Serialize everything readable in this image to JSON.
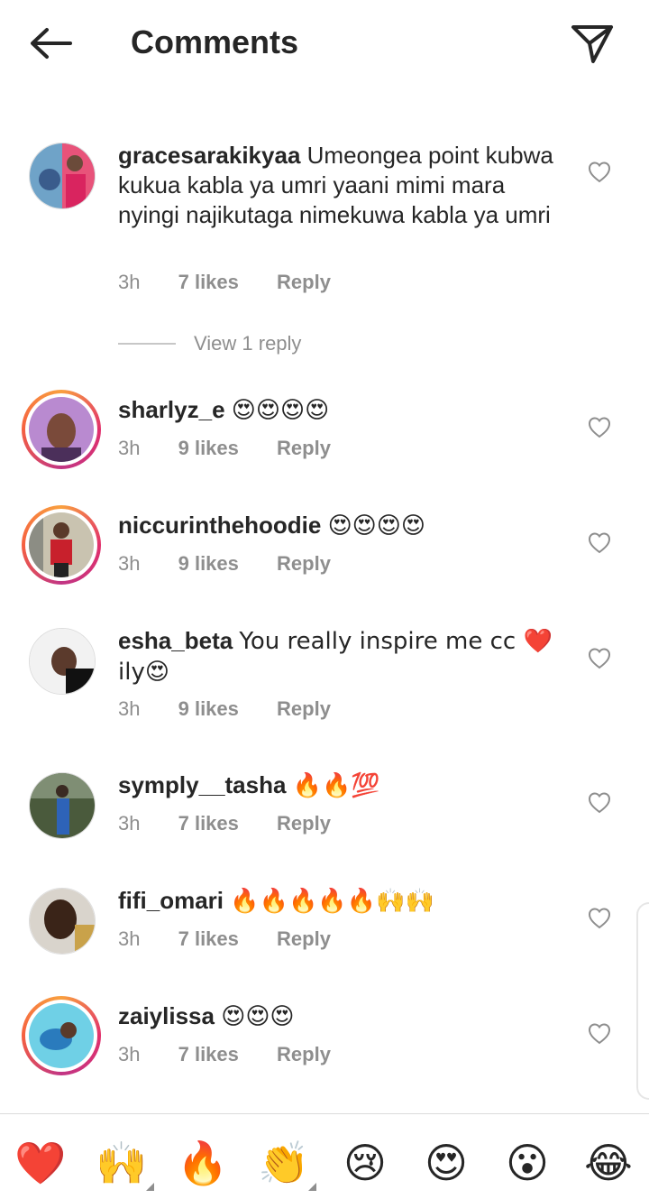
{
  "header": {
    "title": "Comments"
  },
  "comments": [
    {
      "username": "gracesarakikyaa",
      "text": "Umeongea point kubwa kukua kabla ya umri yaani mimi mara nyingi najikutaga nimekuwa kabla ya umri",
      "time": "3h",
      "likes": "7 likes",
      "reply": "Reply"
    },
    {
      "username": "sharlyz_e",
      "text": "😍😍😍😍",
      "time": "3h",
      "likes": "9 likes",
      "reply": "Reply"
    },
    {
      "username": "niccurinthehoodie",
      "text": "😍😍😍😍",
      "time": "3h",
      "likes": "9 likes",
      "reply": "Reply"
    },
    {
      "username": "esha_beta",
      "text": "You really inspire me cc ❤️ ily😍",
      "time": "3h",
      "likes": "9 likes",
      "reply": "Reply"
    },
    {
      "username": "symply__tasha",
      "text": "🔥🔥💯",
      "time": "3h",
      "likes": "7 likes",
      "reply": "Reply"
    },
    {
      "username": "fifi_omari",
      "text": "🔥🔥🔥🔥🔥🙌🙌",
      "time": "3h",
      "likes": "7 likes",
      "reply": "Reply"
    },
    {
      "username": "zaiylissa",
      "text": "😍😍😍",
      "time": "3h",
      "likes": "7 likes",
      "reply": "Reply"
    }
  ],
  "view_reply": "View 1 reply",
  "emoji_bar": [
    "❤️",
    "🙌",
    "🔥",
    "👏",
    "😢",
    "😍",
    "😮",
    "😂"
  ],
  "colors": {
    "text": "#262626",
    "secondary": "#8e8e8e",
    "story_ring_start": "#f9a03f",
    "story_ring_end": "#c13584",
    "divider": "#dbdbdb"
  }
}
